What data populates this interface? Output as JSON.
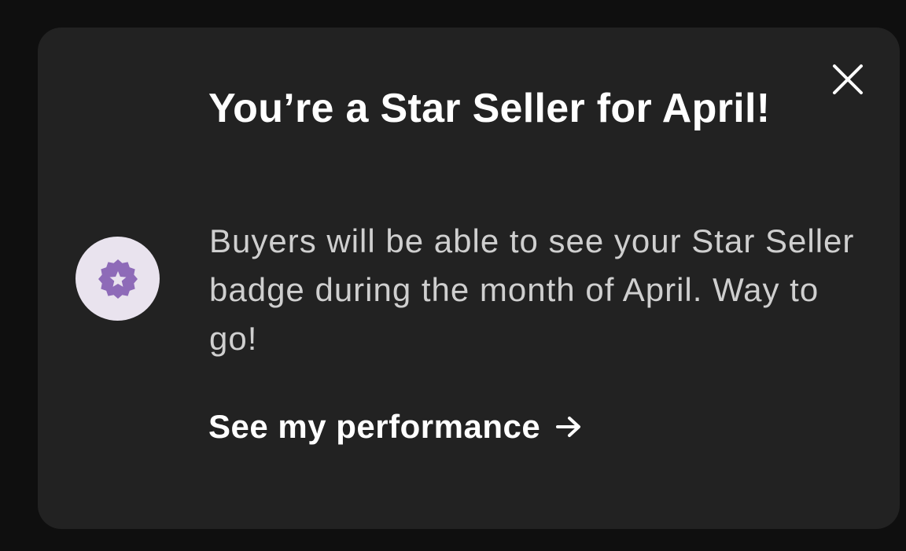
{
  "notification": {
    "title": "You’re a Star Seller for April!",
    "description": "Buyers will be able to see your Star Seller badge during the month of April. Way to go!",
    "link_label": "See my performance",
    "close_icon": "close-icon",
    "badge_icon": "star-seller-badge-icon",
    "arrow_icon": "arrow-right-icon"
  },
  "colors": {
    "page_background": "#0f0f0f",
    "card_background": "#222222",
    "title_text": "#ffffff",
    "body_text": "#cfcfcf",
    "badge_circle": "#e9e3ee",
    "badge_purple": "#8e6bb8"
  }
}
